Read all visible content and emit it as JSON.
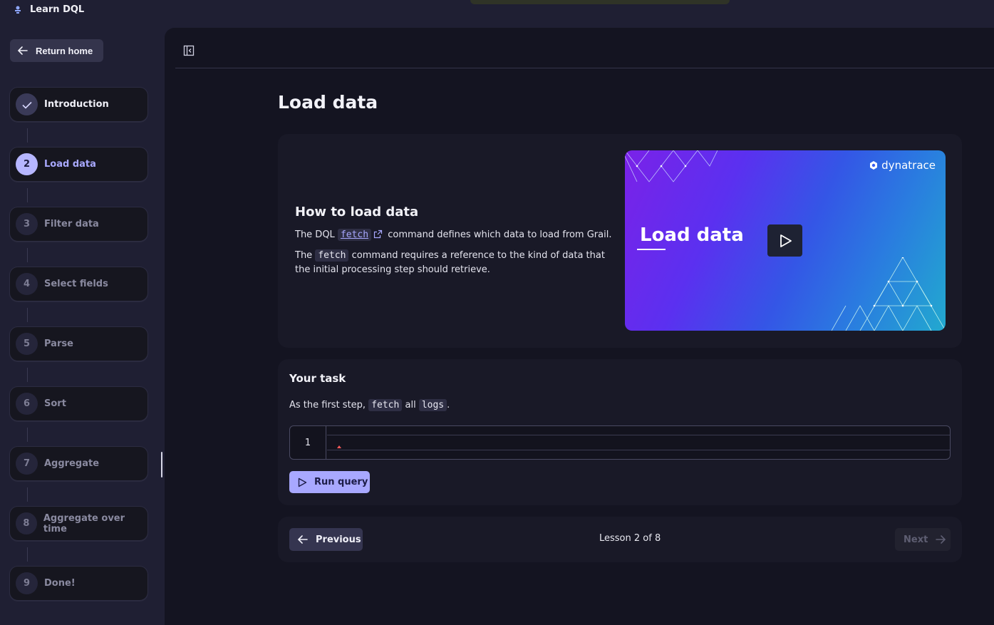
{
  "app": {
    "title": "Learn DQL"
  },
  "sidebar": {
    "return_label": "Return home",
    "steps": [
      {
        "num": "",
        "label": "Introduction",
        "state": "done"
      },
      {
        "num": "2",
        "label": "Load data",
        "state": "active"
      },
      {
        "num": "3",
        "label": "Filter data",
        "state": "pending"
      },
      {
        "num": "4",
        "label": "Select fields",
        "state": "pending"
      },
      {
        "num": "5",
        "label": "Parse",
        "state": "pending"
      },
      {
        "num": "6",
        "label": "Sort",
        "state": "pending"
      },
      {
        "num": "7",
        "label": "Aggregate",
        "state": "pending"
      },
      {
        "num": "8",
        "label": "Aggregate over time",
        "state": "pending"
      },
      {
        "num": "9",
        "label": "Done!",
        "state": "pending"
      }
    ]
  },
  "main": {
    "title": "Load data",
    "lesson": {
      "heading": "How to load data",
      "p1_before": "The DQL",
      "p1_link": "fetch",
      "p1_after": "command defines which data to load from Grail.",
      "p2_before": "The",
      "p2_code": "fetch",
      "p2_after": "command requires a reference to the kind of data that the initial processing step should retrieve."
    },
    "video": {
      "title": "Load data",
      "brand": "dynatrace"
    },
    "task": {
      "heading": "Your task",
      "text_before": "As the first step,",
      "code1": "fetch",
      "text_mid": "all",
      "code2": "logs",
      "text_after": ".",
      "line_number": "1",
      "query_value": "",
      "run_label": "Run query"
    },
    "nav": {
      "previous_label": "Previous",
      "lesson_count": "Lesson 2 of 8",
      "next_label": "Next"
    }
  },
  "colors": {
    "accent": "#a8a8ff",
    "background": "#141421",
    "sidebar": "#1f1f33"
  }
}
